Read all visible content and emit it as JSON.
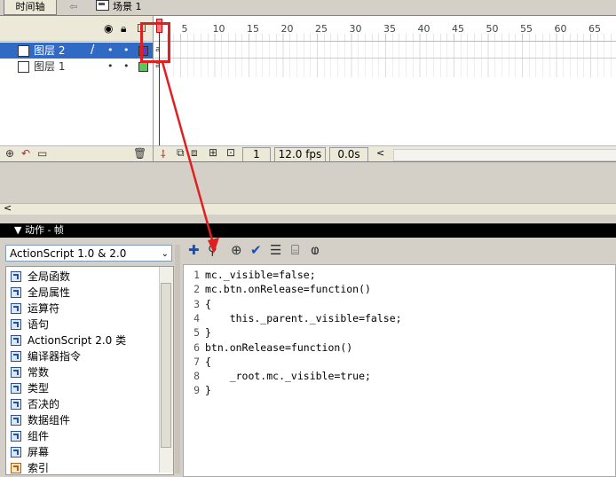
{
  "topbar": {
    "timeline_tab": "时间轴",
    "back_glyph": "⇦",
    "scene_label": "场景 1"
  },
  "timeline": {
    "ruler_ticks": [
      "5",
      "10",
      "15",
      "20",
      "25",
      "30",
      "35",
      "40",
      "45",
      "50",
      "55",
      "60",
      "65"
    ],
    "layers": [
      {
        "name": "图层 2",
        "selected": true,
        "color": "#5b3bc8"
      },
      {
        "name": "图层 1",
        "selected": false,
        "color": "#55cc55"
      }
    ],
    "current_frame": "1",
    "fps": "12.0 fps",
    "elapsed": "0.0s"
  },
  "actions": {
    "title": "▼ 动作 - 帧",
    "version": "ActionScript 1.0 & 2.0",
    "toolbox_items": [
      "全局函数",
      "全局属性",
      "运算符",
      "语句",
      "ActionScript 2.0 类",
      "编译器指令",
      "常数",
      "类型",
      "否决的",
      "数据组件",
      "组件",
      "屏幕",
      "索引"
    ],
    "code_lines": [
      "mc._visible=false;",
      "mc.btn.onRelease=function()",
      "{",
      "    this._parent._visible=false;",
      "}",
      "btn.onRelease=function()",
      "{",
      "    _root.mc._visible=true;",
      "}"
    ],
    "line_numbers": [
      "1",
      "2",
      "3",
      "4",
      "5",
      "6",
      "7",
      "8",
      "9"
    ]
  },
  "colors": {
    "selection": "#316ac5",
    "annotation_red": "#e02020"
  }
}
